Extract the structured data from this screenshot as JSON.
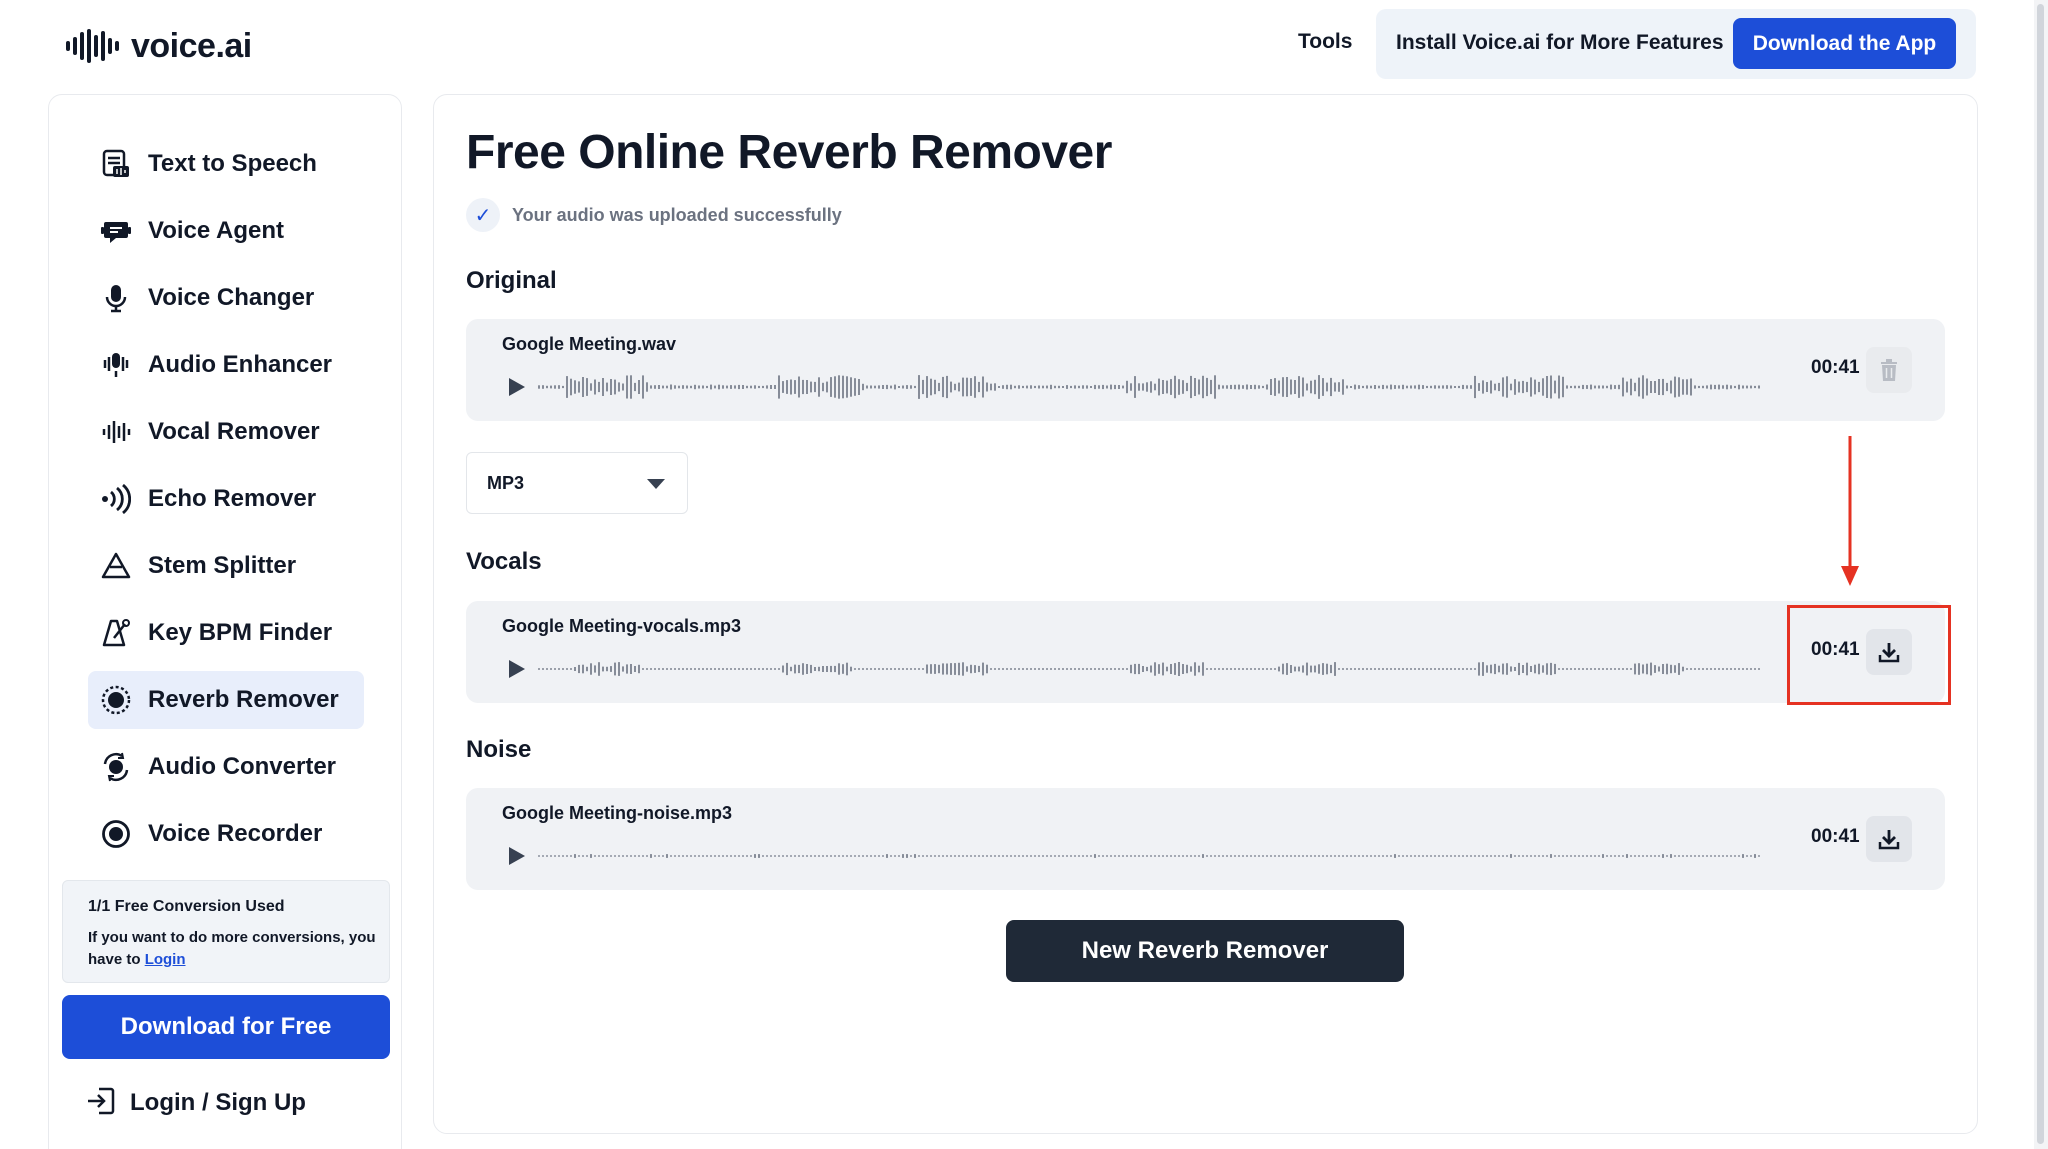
{
  "header": {
    "logo_text": "voice.ai",
    "tools_label": "Tools",
    "install_text": "Install Voice.ai for More Features",
    "download_app_label": "Download the App"
  },
  "sidebar": {
    "items": [
      {
        "label": "Text to Speech",
        "icon": "text-to-speech-icon",
        "active": false
      },
      {
        "label": "Voice Agent",
        "icon": "voice-agent-icon",
        "active": false
      },
      {
        "label": "Voice Changer",
        "icon": "microphone-icon",
        "active": false
      },
      {
        "label": "Audio Enhancer",
        "icon": "audio-enhancer-icon",
        "active": false
      },
      {
        "label": "Vocal Remover",
        "icon": "waveform-icon",
        "active": false
      },
      {
        "label": "Echo Remover",
        "icon": "echo-icon",
        "active": false
      },
      {
        "label": "Stem Splitter",
        "icon": "triangle-icon",
        "active": false
      },
      {
        "label": "Key BPM Finder",
        "icon": "metronome-icon",
        "active": false
      },
      {
        "label": "Reverb Remover",
        "icon": "reverb-icon",
        "active": true
      },
      {
        "label": "Audio Converter",
        "icon": "converter-icon",
        "active": false
      },
      {
        "label": "Voice Recorder",
        "icon": "record-icon",
        "active": false
      }
    ],
    "free_conversion": {
      "title": "1/1 Free Conversion Used",
      "description": "If you want to do more conversions, you have to",
      "login_link": "Login"
    },
    "download_free_label": "Download for Free",
    "login_signup_label": "Login / Sign Up"
  },
  "main": {
    "title": "Free Online Reverb Remover",
    "status": "Your audio was uploaded successfully",
    "original_label": "Original",
    "format_value": "MP3",
    "vocals_label": "Vocals",
    "noise_label": "Noise",
    "new_button_label": "New Reverb Remover",
    "tracks": {
      "original": {
        "filename": "Google Meeting.wav",
        "duration": "00:41",
        "action": "trash-icon"
      },
      "vocals": {
        "filename": "Google Meeting-vocals.mp3",
        "duration": "00:41",
        "action": "download-icon"
      },
      "noise": {
        "filename": "Google Meeting-noise.mp3",
        "duration": "00:41",
        "action": "download-icon"
      }
    }
  },
  "colors": {
    "primary": "#1d4ed8",
    "dark_button": "#1f2937",
    "annotation": "#e53222",
    "active_nav_bg": "#e8eefb"
  }
}
